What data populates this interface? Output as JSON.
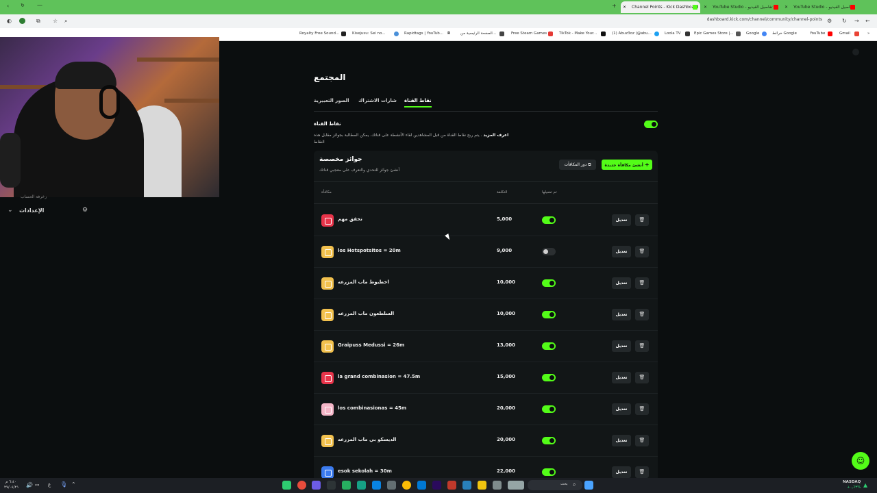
{
  "browser": {
    "tabs": [
      {
        "label": "Channel Points - Kick Dashboard",
        "active": true,
        "favicon_color": "#53fc18"
      },
      {
        "label": "YouTube Studio - تفاصيل الفيديو",
        "active": false,
        "favicon_color": "#ff0000"
      },
      {
        "label": "YouTube Studio - تفاصيل الفيديو",
        "active": false,
        "favicon_color": "#ff0000"
      }
    ],
    "url": "dashboard.kick.com/channel/community/channel-points",
    "bookmarks": [
      "Royalty Free Sound...",
      "Kisejusu: Sei no...",
      "Rapidtags | YouTub...",
      "الصفحة الرئيسية من...",
      "Free Steam Games",
      "TikTok - Make Your...",
      "(1) Abuz3oz (@abu...",
      "Loola TV",
      "Epic Games Store |...",
      "Google",
      "خرائط Google",
      "YouTube",
      "Gmail"
    ]
  },
  "sidebar": {
    "partial_label": "زخرفة الحساب",
    "settings_label": "الإعدادات"
  },
  "page": {
    "title": "المجتمع",
    "tabs": [
      "الصور التعبيرية",
      "شارات الاشتراك",
      "نقاط القناة"
    ],
    "active_tab": "نقاط القناة",
    "channel_points_heading": "نقاط القناة",
    "description_bold": "اعرف المزيد",
    "description": ". يتم ربح نقاط القناة من قبل المشاهدين لقاء الأنشطة على قناتك. يمكن المطالبة بجوائز مقابل هذه النقاط",
    "channel_points_enabled": true
  },
  "rewards_panel": {
    "title": "جوائز مخصصة",
    "subtitle": "أنشئ جوائز للتحدي والتعرف على معجبي قناتك",
    "history_button": "دور المكافآت",
    "new_button": "أنشئ مكافأة جديدة",
    "columns": {
      "reward": "مكافأة",
      "cost": "التكلفة",
      "enabled": "تم تفعيلها"
    },
    "edit_label": "تعديل",
    "rows": [
      {
        "name": "تحقق مهم",
        "cost": "5,000",
        "enabled": true,
        "color": "#e8344a"
      },
      {
        "name": "los Hotspotsitos = 20m",
        "cost": "9,000",
        "enabled": false,
        "color": "#f2c14e"
      },
      {
        "name": "اخطبوط ماب المزرعه",
        "cost": "10,000",
        "enabled": true,
        "color": "#f2c14e"
      },
      {
        "name": "السلطعون ماب المزرعه",
        "cost": "10,000",
        "enabled": true,
        "color": "#f2c14e"
      },
      {
        "name": "Graipuss Medussi = 26m",
        "cost": "13,000",
        "enabled": true,
        "color": "#f2c14e"
      },
      {
        "name": "la grand combinasion = 47.5m",
        "cost": "15,000",
        "enabled": true,
        "color": "#e8344a"
      },
      {
        "name": "los combinasionas = 45m",
        "cost": "20,000",
        "enabled": true,
        "color": "#f5b6c8"
      },
      {
        "name": "الديسكو بي ماب المزرعه",
        "cost": "20,000",
        "enabled": true,
        "color": "#f2c14e"
      },
      {
        "name": "esok sekolah = 30m",
        "cost": "22,000",
        "enabled": true,
        "color": "#3b7bef"
      }
    ]
  },
  "taskbar": {
    "search_placeholder": "بحث",
    "clock_time": "٦:٤٠ م",
    "clock_date": "٢٧/٠٤/٢١",
    "stock_label": "NASDAQ",
    "stock_change": "+٠٫٦٣%",
    "language": "ع"
  },
  "colors": {
    "accent": "#53fc18",
    "background": "#0b0e0f",
    "panel": "#121617"
  }
}
